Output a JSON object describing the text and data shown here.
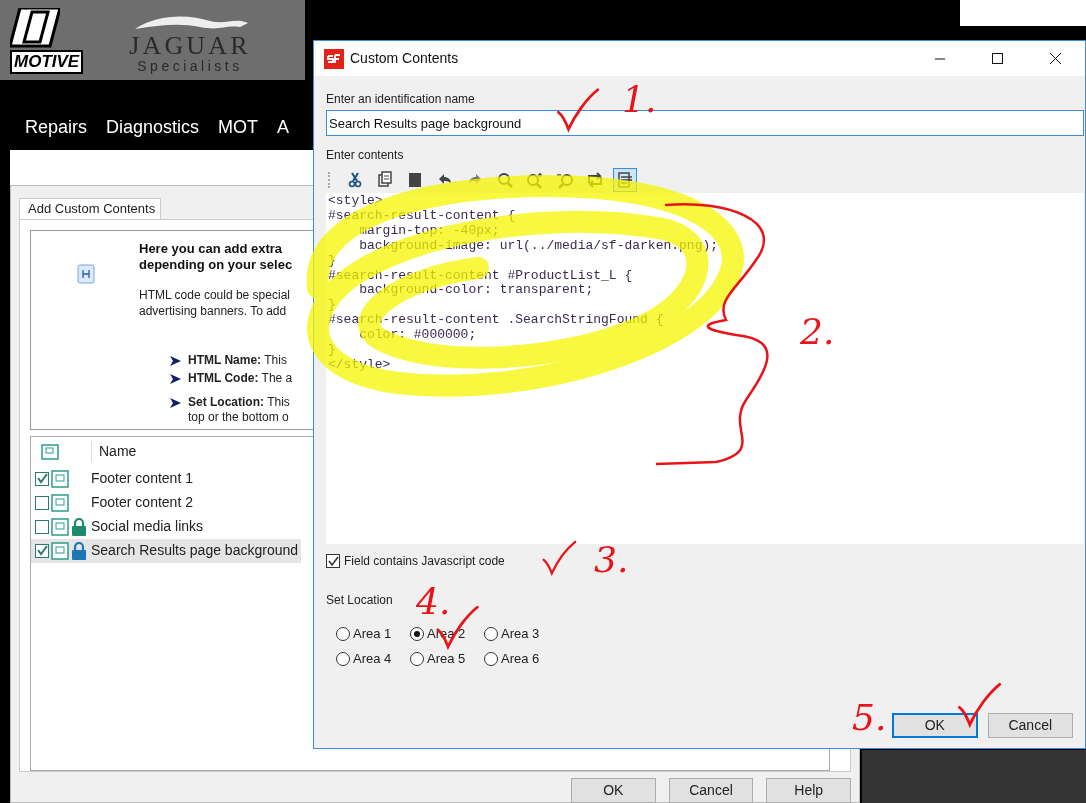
{
  "site": {
    "logo_left": "MOTIVE",
    "logo_brand": "JAGUAR",
    "logo_sub": "Specialists",
    "nav": [
      "Repairs",
      "Diagnostics",
      "MOT",
      "A"
    ]
  },
  "back_dialog": {
    "tab": "Add Custom Contents",
    "intro_heading": [
      "Here you can add extra",
      "depending on your selec"
    ],
    "intro_text": [
      "HTML code could be special",
      "advertising banners. To add"
    ],
    "bullets": [
      {
        "text": "**HTML Name:** This"
      },
      {
        "text": "**HTML Code:** The a"
      },
      {
        "text": "**Set Location:** This",
        "more": "top or the bottom o"
      }
    ],
    "list": {
      "column": "Name",
      "rows": [
        {
          "name": "Footer content 1",
          "checked": true,
          "locked": false,
          "selected": false
        },
        {
          "name": "Footer content 2",
          "checked": false,
          "locked": false,
          "selected": false
        },
        {
          "name": "Social media links",
          "checked": false,
          "locked": true,
          "selected": false
        },
        {
          "name": "Search Results page background",
          "checked": true,
          "locked": true,
          "selected": true
        }
      ]
    },
    "buttons": [
      "OK",
      "Cancel",
      "Help"
    ]
  },
  "dialog": {
    "title": "Custom Contents",
    "name_label": "Enter an identification name",
    "name_value": "Search Results page background",
    "contents_label": "Enter contents",
    "toolbar": [
      {
        "selected": false
      },
      {
        "selected": false
      },
      {
        "selected": false
      },
      {
        "selected": false
      },
      {
        "selected": false
      },
      {
        "selected": false
      },
      {
        "selected": false
      },
      {
        "selected": false
      },
      {
        "selected": false
      },
      {
        "selected": true
      }
    ],
    "code": [
      "<style>",
      "#search-result-content {",
      "    margin-top: -40px;",
      "    background-image: url(../media/sf-darken.png);",
      "}",
      "#search-result-content #ProductList_L {",
      "    background-color: transparent;",
      "}",
      "#search-result-content .SearchStringFound {",
      "    color: #000000;",
      "}",
      "</style>"
    ],
    "js_checkbox": {
      "label": "Field contains Javascript code",
      "checked": true
    },
    "location_label": "Set Location",
    "areas": [
      {
        "label": "Area 1",
        "selected": false
      },
      {
        "label": "Area 2",
        "selected": true
      },
      {
        "label": "Area 3",
        "selected": false
      },
      {
        "label": "Area 4",
        "selected": false
      },
      {
        "label": "Area 5",
        "selected": false
      },
      {
        "label": "Area 6",
        "selected": false
      }
    ],
    "buttons": [
      {
        "label": "OK",
        "default": true
      },
      {
        "label": "Cancel",
        "default": false
      }
    ]
  },
  "annotations": [
    {
      "label": "1."
    },
    {
      "label": "2."
    },
    {
      "label": "3."
    },
    {
      "label": "4."
    },
    {
      "label": "5."
    }
  ]
}
